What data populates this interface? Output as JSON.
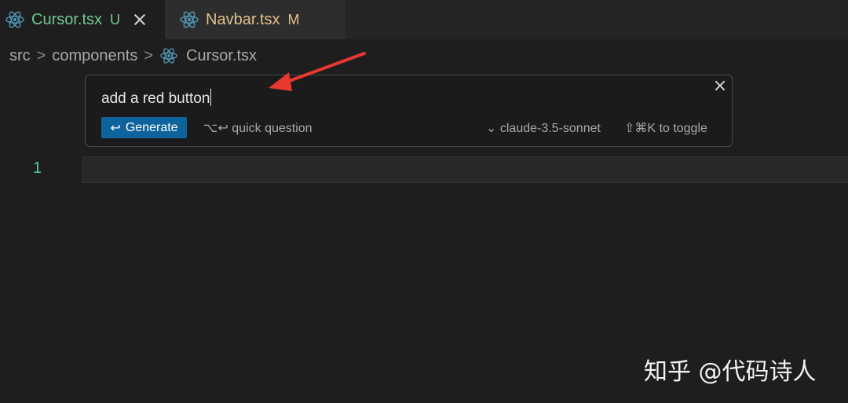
{
  "tabs": [
    {
      "name": "Cursor.tsx",
      "status": "U",
      "active": true,
      "icon": "react-icon"
    },
    {
      "name": "Navbar.tsx",
      "status": "M",
      "active": false,
      "icon": "react-icon"
    }
  ],
  "breadcrumb": {
    "items": [
      "src",
      "components",
      "Cursor.tsx"
    ],
    "separator": ">"
  },
  "editor": {
    "line_number": "1"
  },
  "prompt": {
    "input_value": "add a red button",
    "generate_icon": "↩",
    "generate_label": "Generate",
    "quick_question": "⌥↩ quick question",
    "model_chevron": "⌄",
    "model": "claude-3.5-sonnet",
    "toggle_hint": "⇧⌘K to toggle"
  },
  "watermark": "知乎 @代码诗人",
  "colors": {
    "accent": "#0e639c",
    "untracked": "#73c991",
    "modified": "#e2c08d",
    "arrow": "#e8382f"
  }
}
